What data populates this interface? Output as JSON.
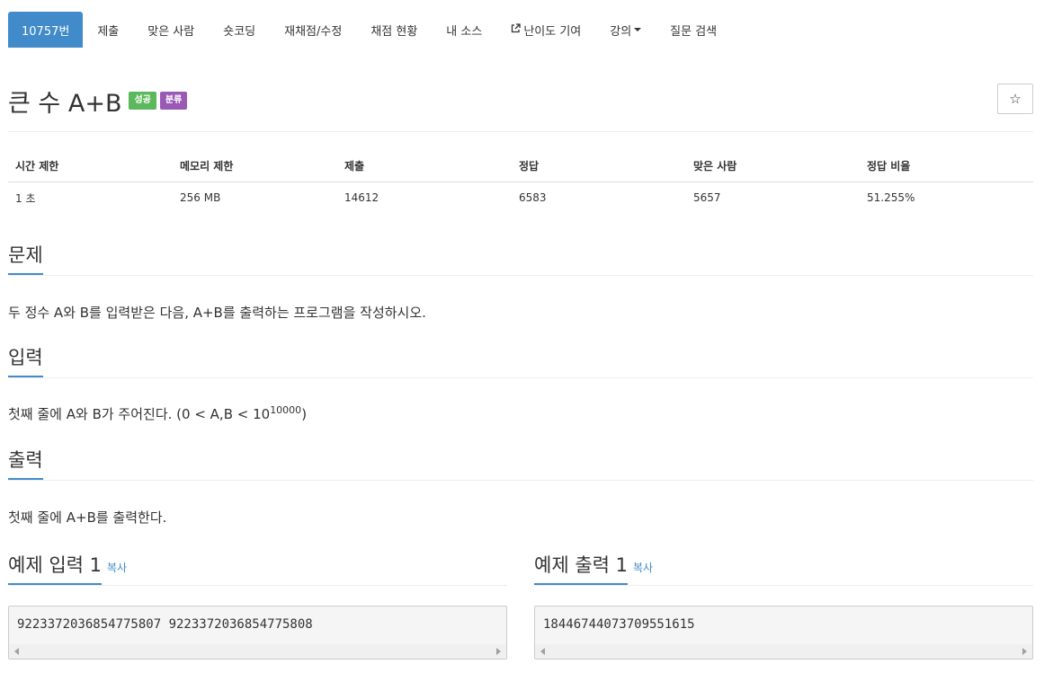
{
  "nav": {
    "tabs": [
      {
        "label": "10757번",
        "active": true
      },
      {
        "label": "제출"
      },
      {
        "label": "맞은 사람"
      },
      {
        "label": "숏코딩"
      },
      {
        "label": "재채점/수정"
      },
      {
        "label": "채점 현황"
      },
      {
        "label": "내 소스"
      },
      {
        "label": "난이도 기여",
        "icon": "external-link-icon"
      },
      {
        "label": "강의",
        "icon": "caret-down-icon"
      },
      {
        "label": "질문 검색"
      }
    ]
  },
  "problem": {
    "title": "큰 수 A+B",
    "badge_success": "성공",
    "badge_category": "분류",
    "star": "☆"
  },
  "stats": {
    "headers": [
      "시간 제한",
      "메모리 제한",
      "제출",
      "정답",
      "맞은 사람",
      "정답 비율"
    ],
    "values": [
      "1 초",
      "256 MB",
      "14612",
      "6583",
      "5657",
      "51.255%"
    ]
  },
  "sections": {
    "description_title": "문제",
    "description_text": "두 정수 A와 B를 입력받은 다음, A+B를 출력하는 프로그램을 작성하시오.",
    "input_title": "입력",
    "input_text_pre": "첫째 줄에 A와 B가 주어진다. (0 < A,B < 10",
    "input_text_sup": "10000",
    "input_text_post": ")",
    "output_title": "출력",
    "output_text": "첫째 줄에 A+B를 출력한다."
  },
  "samples": {
    "input_title": "예제 입력 1",
    "output_title": "예제 출력 1",
    "copy_label": "복사",
    "input_value": "9223372036854775807 9223372036854775808",
    "output_value": "18446744073709551615"
  }
}
